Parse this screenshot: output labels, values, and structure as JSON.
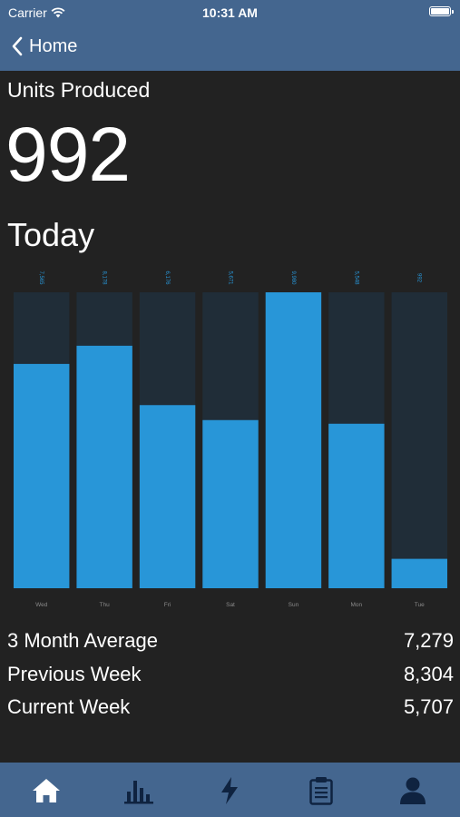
{
  "status_bar": {
    "carrier": "Carrier",
    "time": "10:31 AM"
  },
  "nav": {
    "back_label": "Home"
  },
  "header": {
    "title": "Units Produced",
    "value": "992",
    "period": "Today"
  },
  "colors": {
    "accent": "#2896d8",
    "track": "#202d38",
    "bar_background": "#44668f",
    "background": "#222222"
  },
  "chart_data": {
    "type": "bar",
    "title": "",
    "xlabel": "",
    "ylabel": "",
    "categories": [
      "Wed",
      "Thu",
      "Fri",
      "Sat",
      "Sun",
      "Mon",
      "Tue"
    ],
    "values": [
      7565,
      8178,
      6176,
      5671,
      9980,
      5548,
      992
    ],
    "value_labels": [
      "7,565",
      "8,178",
      "6,176",
      "5,671",
      "9,980",
      "5,548",
      "992"
    ],
    "ylim": [
      0,
      9980
    ],
    "grid": false,
    "legend": "none"
  },
  "stats": [
    {
      "label": "3 Month Average",
      "value": "7,279"
    },
    {
      "label": "Previous Week",
      "value": "8,304"
    },
    {
      "label": "Current Week",
      "value": "5,707"
    }
  ],
  "tabs": [
    {
      "name": "home-icon",
      "active": true
    },
    {
      "name": "bar-chart-icon",
      "active": false
    },
    {
      "name": "lightning-icon",
      "active": false
    },
    {
      "name": "clipboard-icon",
      "active": false
    },
    {
      "name": "person-icon",
      "active": false
    }
  ]
}
